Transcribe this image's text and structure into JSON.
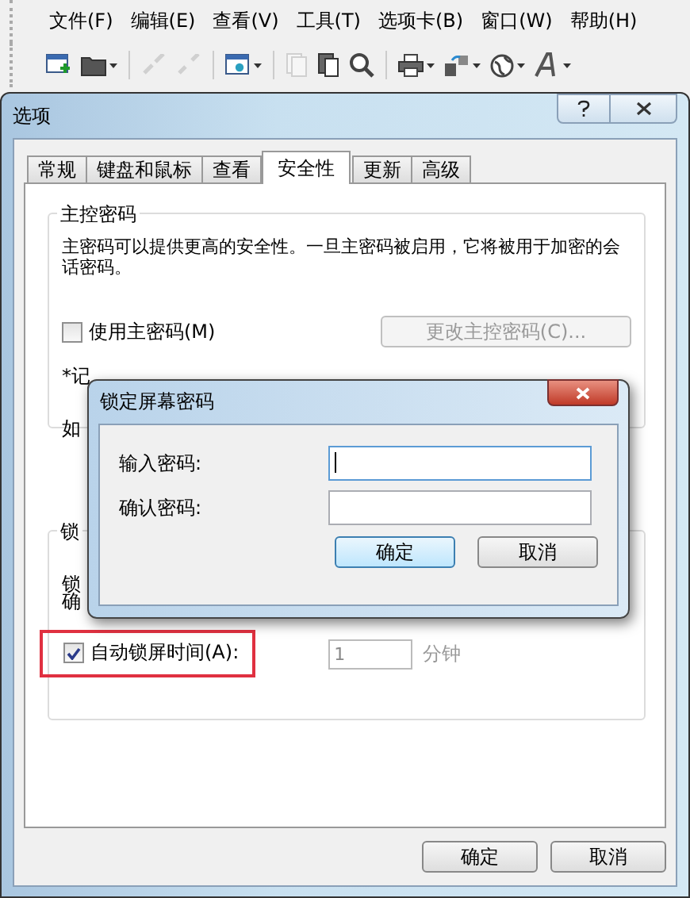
{
  "menu": [
    {
      "label": "文件(F)"
    },
    {
      "label": "编辑(E)"
    },
    {
      "label": "查看(V)"
    },
    {
      "label": "工具(T)"
    },
    {
      "label": "选项卡(B)"
    },
    {
      "label": "窗口(W)"
    },
    {
      "label": "帮助(H)"
    }
  ],
  "toolbar": [
    {
      "kind": "new",
      "disabled": false,
      "dropdown": false
    },
    {
      "kind": "folder",
      "disabled": false,
      "dropdown": true
    },
    {
      "kind": "sep"
    },
    {
      "kind": "link",
      "disabled": true,
      "dropdown": false
    },
    {
      "kind": "unlink",
      "disabled": true,
      "dropdown": false
    },
    {
      "kind": "sep"
    },
    {
      "kind": "settings",
      "disabled": false,
      "dropdown": true
    },
    {
      "kind": "sep"
    },
    {
      "kind": "copy",
      "disabled": true,
      "dropdown": false
    },
    {
      "kind": "paste",
      "disabled": false,
      "dropdown": false
    },
    {
      "kind": "search",
      "disabled": false,
      "dropdown": false
    },
    {
      "kind": "sep"
    },
    {
      "kind": "print",
      "disabled": false,
      "dropdown": true
    },
    {
      "kind": "transfer",
      "disabled": false,
      "dropdown": true
    },
    {
      "kind": "globe",
      "disabled": false,
      "dropdown": true
    },
    {
      "kind": "font",
      "disabled": false,
      "dropdown": true
    }
  ],
  "window": {
    "title": "选项"
  },
  "tabs": [
    {
      "label": "常规",
      "selected": false
    },
    {
      "label": "键盘和鼠标",
      "selected": false
    },
    {
      "label": "查看",
      "selected": false
    },
    {
      "label": "安全性",
      "selected": true
    },
    {
      "label": "更新",
      "selected": false
    },
    {
      "label": "高级",
      "selected": false
    }
  ],
  "master_password": {
    "legend": "主控密码",
    "description": "主密码可以提供更高的安全性。一旦主密码被启用，它将被用于加密的会话密码。",
    "checkbox": {
      "label": "使用主密码(M)",
      "checked": false
    },
    "change_button": {
      "label": "更改主控密码(C)...",
      "disabled": true
    },
    "note": "*记",
    "line_2": "如"
  },
  "lock_section": {
    "legend": "锁",
    "lines": [
      "锁",
      "确"
    ],
    "auto_lock": {
      "label": "自动锁屏时间(A):",
      "checked": true,
      "highlighted": true
    },
    "minutes": {
      "value": "1",
      "unit": "分钟"
    }
  },
  "buttons": [
    {
      "label": "确定"
    },
    {
      "label": "取消"
    }
  ],
  "dialog": {
    "title": "锁定屏幕密码",
    "fields": [
      {
        "label": "输入密码:",
        "focused": true
      },
      {
        "label": "确认密码:",
        "focused": false
      }
    ],
    "buttons": [
      {
        "label": "确定",
        "default": true
      },
      {
        "label": "取消",
        "default": false
      }
    ]
  }
}
